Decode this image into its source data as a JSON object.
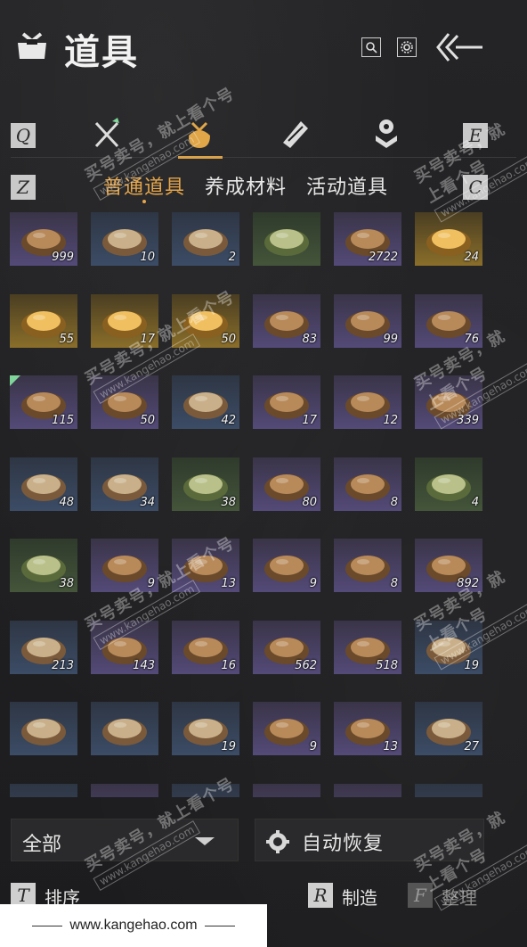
{
  "header": {
    "title": "道具",
    "icons": [
      "bag-logo-icon",
      "search-icon",
      "gear-icon",
      "back-arrow-icon"
    ]
  },
  "category_bar": {
    "left_key": "Q",
    "right_key": "E",
    "categories": [
      {
        "icon": "sword-icon",
        "active": false
      },
      {
        "icon": "pouch-icon",
        "active": true
      },
      {
        "icon": "scroll-icon",
        "active": false
      },
      {
        "icon": "gem-icon",
        "active": false
      }
    ]
  },
  "subtabs": {
    "left_key": "Z",
    "right_key": "C",
    "tabs": [
      "普通道具",
      "养成材料",
      "活动道具"
    ],
    "active_index": 0
  },
  "items": [
    {
      "count": "999",
      "rarity": "purple",
      "icon": "firewood-icon"
    },
    {
      "count": "10",
      "rarity": "blue",
      "icon": "rice-sack-icon"
    },
    {
      "count": "2",
      "rarity": "blue",
      "icon": "jar-icon"
    },
    {
      "count": "",
      "rarity": "green",
      "icon": "tofu-cake-icon"
    },
    {
      "count": "2722",
      "rarity": "purple",
      "icon": "coin-string-icon"
    },
    {
      "count": "24",
      "rarity": "gold",
      "icon": "cauldron-icon"
    },
    {
      "count": "55",
      "rarity": "gold",
      "icon": "gold-ring-icon"
    },
    {
      "count": "17",
      "rarity": "gold",
      "icon": "gold-ingot-icon"
    },
    {
      "count": "50",
      "rarity": "gold",
      "icon": "ancient-coin-icon"
    },
    {
      "count": "83",
      "rarity": "purple",
      "icon": "jade-ore-icon"
    },
    {
      "count": "99",
      "rarity": "purple",
      "icon": "jade-ore-icon"
    },
    {
      "count": "76",
      "rarity": "purple",
      "icon": "clay-pot-dish-icon"
    },
    {
      "count": "115",
      "rarity": "purple",
      "icon": "steamed-buns-icon",
      "tag": true
    },
    {
      "count": "50",
      "rarity": "purple",
      "icon": "fish-soup-icon"
    },
    {
      "count": "42",
      "rarity": "blue",
      "icon": "egg-soup-icon"
    },
    {
      "count": "17",
      "rarity": "purple",
      "icon": "braised-meat-icon"
    },
    {
      "count": "12",
      "rarity": "purple",
      "icon": "grilled-fish-icon"
    },
    {
      "count": "339",
      "rarity": "purple",
      "icon": "beef-bowl-icon"
    },
    {
      "count": "48",
      "rarity": "blue",
      "icon": "egg-dish-icon"
    },
    {
      "count": "34",
      "rarity": "blue",
      "icon": "fish-plate-icon"
    },
    {
      "count": "38",
      "rarity": "green",
      "icon": "okra-plate-icon"
    },
    {
      "count": "80",
      "rarity": "purple",
      "icon": "sausage-icon"
    },
    {
      "count": "8",
      "rarity": "purple",
      "icon": "flatbread-icon"
    },
    {
      "count": "4",
      "rarity": "green",
      "icon": "stir-fry-icon"
    },
    {
      "count": "38",
      "rarity": "green",
      "icon": "clay-pot-icon"
    },
    {
      "count": "9",
      "rarity": "purple",
      "icon": "meat-plate-icon"
    },
    {
      "count": "13",
      "rarity": "purple",
      "icon": "noodle-bowl-icon"
    },
    {
      "count": "9",
      "rarity": "purple",
      "icon": "braised-beef-icon"
    },
    {
      "count": "8",
      "rarity": "purple",
      "icon": "clam-dish-icon"
    },
    {
      "count": "892",
      "rarity": "purple",
      "icon": "dumpling-bowl-icon"
    },
    {
      "count": "213",
      "rarity": "blue",
      "icon": "chicken-plate-icon"
    },
    {
      "count": "143",
      "rarity": "purple",
      "icon": "meatball-icon"
    },
    {
      "count": "16",
      "rarity": "purple",
      "icon": "pancakes-icon"
    },
    {
      "count": "562",
      "rarity": "purple",
      "icon": "stew-pot-icon"
    },
    {
      "count": "518",
      "rarity": "purple",
      "icon": "bun-plate-icon"
    },
    {
      "count": "19",
      "rarity": "blue",
      "icon": "steak-plate-icon"
    },
    {
      "count": "",
      "rarity": "blue",
      "icon": "tofu-icon"
    },
    {
      "count": "",
      "rarity": "blue",
      "icon": "shrimp-plate-icon"
    },
    {
      "count": "19",
      "rarity": "blue",
      "icon": "burger-icon"
    },
    {
      "count": "9",
      "rarity": "purple",
      "icon": "platter-icon"
    },
    {
      "count": "13",
      "rarity": "purple",
      "icon": "cake-icon"
    },
    {
      "count": "27",
      "rarity": "blue",
      "icon": "hotpot-icon"
    },
    {
      "count": "",
      "rarity": "blue",
      "icon": "soup-icon"
    },
    {
      "count": "",
      "rarity": "purple",
      "icon": "curry-icon"
    },
    {
      "count": "",
      "rarity": "blue",
      "icon": "noodle-icon"
    },
    {
      "count": "",
      "rarity": "purple",
      "icon": "grain-icon"
    },
    {
      "count": "",
      "rarity": "purple",
      "icon": "red-soup-icon"
    },
    {
      "count": "",
      "rarity": "blue",
      "icon": "fruit-icon"
    }
  ],
  "bottom": {
    "filter_label": "全部",
    "auto_restore_label": "自动恢复",
    "sort_key": "T",
    "sort_label": "排序",
    "craft_key": "R",
    "craft_label": "制造",
    "organize_key": "F",
    "organize_label": "整理"
  },
  "watermark": {
    "text": "买号卖号，就上看个号",
    "url": "www.kangehao.com",
    "small": "看个号",
    "footer_url": "www.kangehao.com"
  }
}
